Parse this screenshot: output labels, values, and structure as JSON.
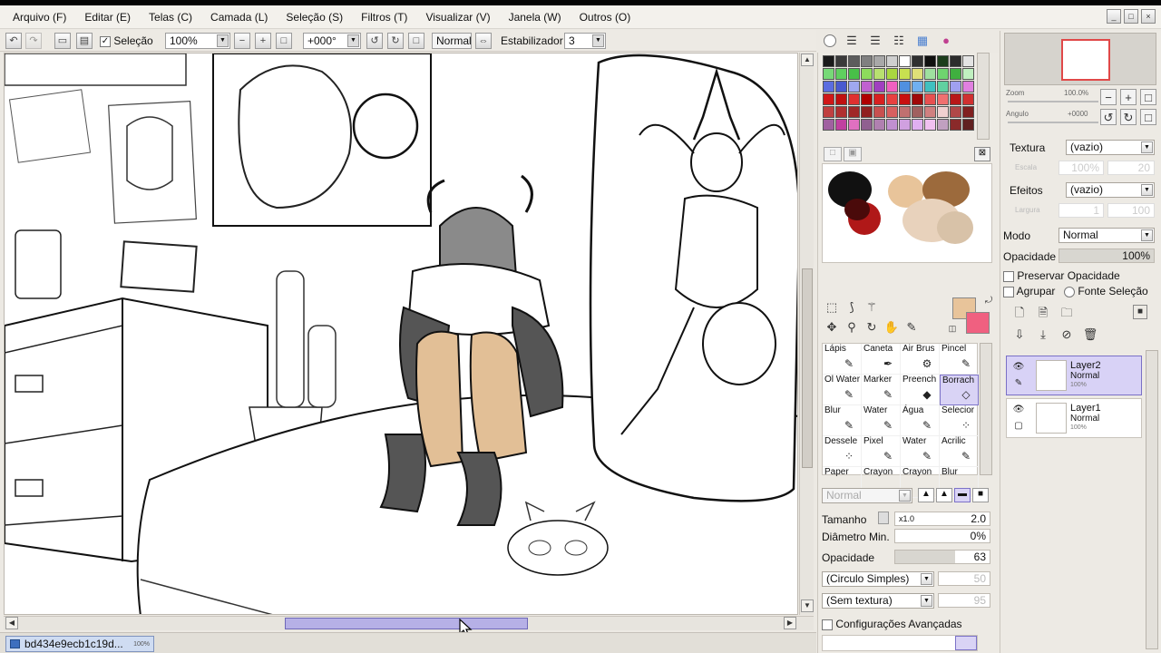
{
  "menu": [
    "Arquivo (F)",
    "Editar (E)",
    "Telas (C)",
    "Camada (L)",
    "Seleção (S)",
    "Filtros (T)",
    "Visualizar (V)",
    "Janela (W)",
    "Outros (O)"
  ],
  "toolbar": {
    "selection_label": "Seleção",
    "zoom_value": "100%",
    "rotation_value": "+000°",
    "blend_mode": "Normal",
    "stabilizer_label": "Estabilizador",
    "stabilizer_value": "3"
  },
  "document": {
    "tab_name": "bd434e9ecb1c19d...",
    "tab_zoom": "100%"
  },
  "swatch_colors": [
    "#1a1a1a",
    "#3a3a3a",
    "#5c5c5c",
    "#808080",
    "#a8a8a8",
    "#cfcfcf",
    "#ffffff",
    "#303030",
    "#101010",
    "#1c3d1c",
    "#2c2c2c",
    "#e4e4e4",
    "#77d977",
    "#5fcf5f",
    "#48c048",
    "#8ddc5c",
    "#b8e070",
    "#a9d840",
    "#c8e050",
    "#e0e078",
    "#9fe09f",
    "#6fd46f",
    "#3fb03f",
    "#c0f0c0",
    "#5b6de0",
    "#4a5ad0",
    "#9fa8f0",
    "#c060d0",
    "#a040c0",
    "#f060c0",
    "#5090e0",
    "#70b0f0",
    "#40c0c0",
    "#60d0a0",
    "#a0a0f0",
    "#e080e0",
    "#d01818",
    "#c01010",
    "#e03030",
    "#b00000",
    "#d82020",
    "#e84040",
    "#c81010",
    "#a00808",
    "#e85050",
    "#f07070",
    "#b81818",
    "#d03030",
    "#c04040",
    "#b03030",
    "#a02828",
    "#902020",
    "#c85050",
    "#d86060",
    "#c07070",
    "#a06060",
    "#d08080",
    "#f0d0d0",
    "#b04848",
    "#802020",
    "#a060a0",
    "#c040a0",
    "#e070c0",
    "#906090",
    "#b080b0",
    "#c090d0",
    "#d0a0e0",
    "#e0b0f0",
    "#f0c0f0",
    "#c0a0c0",
    "#8a2a2a",
    "#602020"
  ],
  "brushes": [
    {
      "label": "Lápis",
      "icon": "✎"
    },
    {
      "label": "Caneta",
      "icon": "✒"
    },
    {
      "label": "Air Brus",
      "icon": "⚙"
    },
    {
      "label": "Pincel",
      "icon": "✎"
    },
    {
      "label": "Ol Water",
      "icon": "✎"
    },
    {
      "label": "Marker",
      "icon": "✎"
    },
    {
      "label": "Preench",
      "icon": "◆"
    },
    {
      "label": "Borrach",
      "icon": "◇"
    },
    {
      "label": "Blur",
      "icon": "✎"
    },
    {
      "label": "Water",
      "icon": "✎"
    },
    {
      "label": "Água",
      "icon": "✎"
    },
    {
      "label": "Selecior",
      "icon": "⁘"
    },
    {
      "label": "Dessele",
      "icon": "⁘"
    },
    {
      "label": "Pixel",
      "icon": "✎"
    },
    {
      "label": "Water",
      "icon": "✎"
    },
    {
      "label": "Acrilic",
      "icon": "✎"
    },
    {
      "label": "Paper",
      "icon": ""
    },
    {
      "label": "Crayon",
      "icon": ""
    },
    {
      "label": "Crayon",
      "icon": ""
    },
    {
      "label": "Blur",
      "icon": ""
    }
  ],
  "brush_settings": {
    "blend_mode": "Normal",
    "size_label": "Tamanho",
    "size_multiplier": "x1.0",
    "size_value": "2.0",
    "min_diameter_label": "Diâmetro Min.",
    "min_diameter_value": "0%",
    "opacity_label": "Opacidade",
    "opacity_value": "63",
    "shape": "(Circulo Simples)",
    "shape_value": "50",
    "texture": "(Sem textura)",
    "texture_value": "95",
    "advanced_label": "Configurações Avançadas"
  },
  "navigator": {
    "zoom_label": "Zoom",
    "zoom_value": "100.0%",
    "angle_label": "Angulo",
    "angle_value": "+0000"
  },
  "layer_props": {
    "texture_label": "Textura",
    "texture_value": "(vazio)",
    "scale_label": "Escala",
    "scale_value": "100%",
    "scale_num": "20",
    "effects_label": "Efeitos",
    "effects_value": "(vazio)",
    "width_label": "Largura",
    "width_value": "1",
    "width_num": "100",
    "mode_label": "Modo",
    "mode_value": "Normal",
    "opacity_label": "Opacidade",
    "opacity_value": "100%",
    "preserve_label": "Preservar Opacidade",
    "group_label": "Agrupar",
    "source_label": "Fonte Seleção"
  },
  "layers": [
    {
      "name": "Layer2",
      "mode": "Normal",
      "opacity": "100%",
      "active": true
    },
    {
      "name": "Layer1",
      "mode": "Normal",
      "opacity": "100%",
      "active": false
    }
  ],
  "colors": {
    "primary": "#e8c49a",
    "secondary": "#f06080",
    "selection_accent": "#b6b0e6"
  },
  "icons": [
    "minimize-icon",
    "maximize-icon",
    "close-icon",
    "eye-icon",
    "new-layer-icon",
    "trash-icon",
    "folder-icon",
    "brush-icon",
    "eraser-icon",
    "move-icon",
    "zoom-icon",
    "rotate-icon",
    "hand-icon",
    "eyedropper-icon",
    "mouse-cursor-icon"
  ]
}
